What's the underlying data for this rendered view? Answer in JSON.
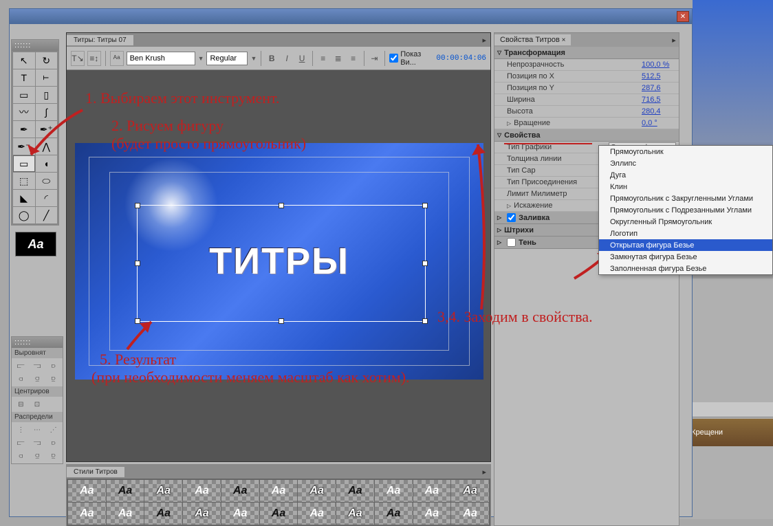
{
  "titler_tab": "Титры: Титры 07",
  "styles_tab": "Стили Титров",
  "props_tab": "Свойства Титров",
  "toolbar": {
    "font": "Ben Krush",
    "style": "Regular",
    "show_video": "Показ Ви...",
    "timecode": "00:00:04:06"
  },
  "canvas_text": "ТИТРЫ",
  "sections": {
    "transform": "Трансформация",
    "props": "Свойства",
    "fill": "Заливка",
    "strokes": "Штрихи",
    "shadow": "Тень"
  },
  "transform_rows": [
    {
      "label": "Непрозрачность",
      "value": "100,0 %"
    },
    {
      "label": "Позиция по X",
      "value": "512,5"
    },
    {
      "label": "Позиция по Y",
      "value": "287,6"
    },
    {
      "label": "Ширина",
      "value": "716,5"
    },
    {
      "label": "Высота",
      "value": "280,4"
    },
    {
      "label": "Вращение",
      "value": "0,0 °"
    }
  ],
  "graphic_rows": [
    {
      "label": "Тип Графики",
      "value": "Открытая фигу..."
    },
    {
      "label": "Толщина линии",
      "value": ""
    },
    {
      "label": "Тип Cap",
      "value": ""
    },
    {
      "label": "Тип Присоединения",
      "value": ""
    },
    {
      "label": "Лимит Милиметр",
      "value": ""
    },
    {
      "label": "Искажение",
      "value": ""
    }
  ],
  "dd_options": [
    "Прямоугольник",
    "Эллипс",
    "Дуга",
    "Клин",
    "Прямоугольник с Закругленными Углами",
    "Прямоугольник с Подрезанными Углами",
    "Округленный Прямоугольник",
    "Логотип",
    "Открытая фигура Безье",
    "Замкнутая фигура Безье",
    "Заполненная фигура Безье"
  ],
  "dd_selected_index": 8,
  "align_labels": {
    "align": "Выровнят",
    "center": "Центриров",
    "distrib": "Распредели"
  },
  "annotations": {
    "a1": "1. Выбираем этот инструмент.",
    "a2a": "2. Рисуем фигуру",
    "a2b": "(будет просто прямоугольник)",
    "a34": "3,4. Заходим в свойства.",
    "a5a": "5. Результат",
    "a5b": "(при необходимости меняем масштаб как хотим)."
  },
  "thumb_text": "Aa",
  "style_samples": [
    "Aa",
    "Aa",
    "Aa",
    "Aa",
    "Aa",
    "Aa",
    "Aa",
    "Aa",
    "Aa",
    "Aa",
    "Aa",
    "Aa",
    "Aa",
    "Aa",
    "Aa",
    "Aa",
    "Aa",
    "Aa",
    "Aa",
    "Aa",
    "Aa",
    "Aa"
  ],
  "timeline_clips": [
    "ени",
    "Крещени"
  ]
}
